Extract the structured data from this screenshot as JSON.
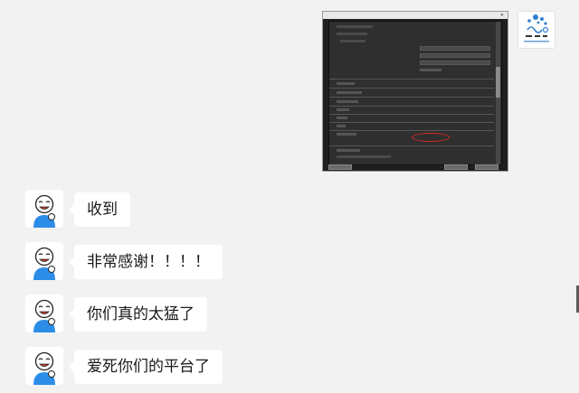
{
  "colors": {
    "background": "#f2f2f2",
    "bubble": "#ffffff",
    "text": "#1a1a1a",
    "annotation_oval": "#e12626"
  },
  "messages": [
    {
      "text": "收到"
    },
    {
      "text": "非常感谢！！！！"
    },
    {
      "text": "你们真的太猛了"
    },
    {
      "text": "爱死你们的平台了"
    }
  ],
  "icons": {
    "avatar": "smiling-figure-avatar-icon",
    "own_avatar": "dots-logo-avatar-icon"
  }
}
